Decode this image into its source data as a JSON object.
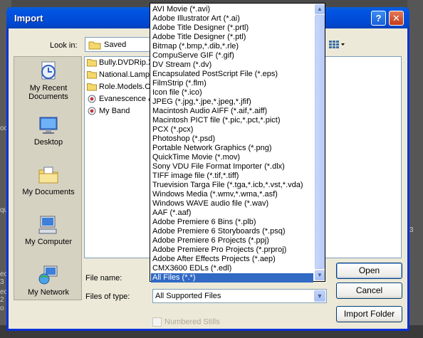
{
  "background": {
    "left_fragments": [
      "ook",
      "que",
      "eo 3",
      "eo 2",
      "o 1"
    ],
    "right_fragments": [
      "3"
    ]
  },
  "dialog": {
    "title": "Import",
    "help_glyph": "?",
    "close_glyph": "✕"
  },
  "look_in": {
    "label": "Look in:",
    "value": "Saved"
  },
  "places": [
    {
      "label": "My Recent Documents",
      "icon": "recent-documents-icon"
    },
    {
      "label": "Desktop",
      "icon": "desktop-icon"
    },
    {
      "label": "My Documents",
      "icon": "my-documents-icon"
    },
    {
      "label": "My Computer",
      "icon": "my-computer-icon"
    },
    {
      "label": "My Network",
      "icon": "my-network-icon"
    }
  ],
  "files": [
    {
      "name": "Bully.DVDRip.Xv",
      "type": "folder"
    },
    {
      "name": "National.Lampoo",
      "type": "folder"
    },
    {
      "name": "Role.Models.CA",
      "type": "folder"
    },
    {
      "name": "Evanescence &",
      "type": "media"
    },
    {
      "name": "My Band",
      "type": "media"
    }
  ],
  "file_name": {
    "label": "File name:",
    "value": ""
  },
  "file_type": {
    "label": "Files of type:",
    "value": "All Supported Files",
    "options": [
      "AVI Movie (*.avi)",
      "Adobe Illustrator Art (*.ai)",
      "Adobe Title Designer (*.prtl)",
      "Adobe Title Designer (*.ptl)",
      "Bitmap (*.bmp,*.dib,*.rle)",
      "CompuServe GIF (*.gif)",
      "DV Stream (*.dv)",
      "Encapsulated PostScript File (*.eps)",
      "FilmStrip (*.flm)",
      "Icon file (*.ico)",
      "JPEG (*.jpg,*.jpe,*.jpeg,*.jfif)",
      "Macintosh Audio AIFF (*.aif,*.aiff)",
      "Macintosh PICT file (*.pic,*.pct,*.pict)",
      "PCX (*.pcx)",
      "Photoshop (*.psd)",
      "Portable Network Graphics (*.png)",
      "QuickTime Movie (*.mov)",
      "Sony VDU File Format Importer (*.dlx)",
      "TIFF image file (*.tif,*.tiff)",
      "Truevision Targa File (*.tga,*.icb,*.vst,*.vda)",
      "Windows Media (*.wmv,*.wma,*.asf)",
      "Windows WAVE audio file (*.wav)",
      "AAF (*.aaf)",
      "Adobe Premiere 6 Bins (*.plb)",
      "Adobe Premiere 6 Storyboards (*.psq)",
      "Adobe Premiere 6 Projects (*.ppj)",
      "Adobe Premiere Pro Projects (*.prproj)",
      "Adobe After Effects Projects (*.aep)",
      "CMX3600 EDLs (*.edl)",
      "All Files (*.*)"
    ],
    "highlighted_option": "All Files (*.*)"
  },
  "numbered_stills": {
    "label": "Numbered Stills",
    "checked": false,
    "enabled": false
  },
  "buttons": {
    "open": "Open",
    "cancel": "Cancel",
    "import_folder": "Import Folder"
  },
  "colors": {
    "title_bar": "#0054e3",
    "dialog_face": "#ece9d8",
    "selection": "#316ac5"
  }
}
